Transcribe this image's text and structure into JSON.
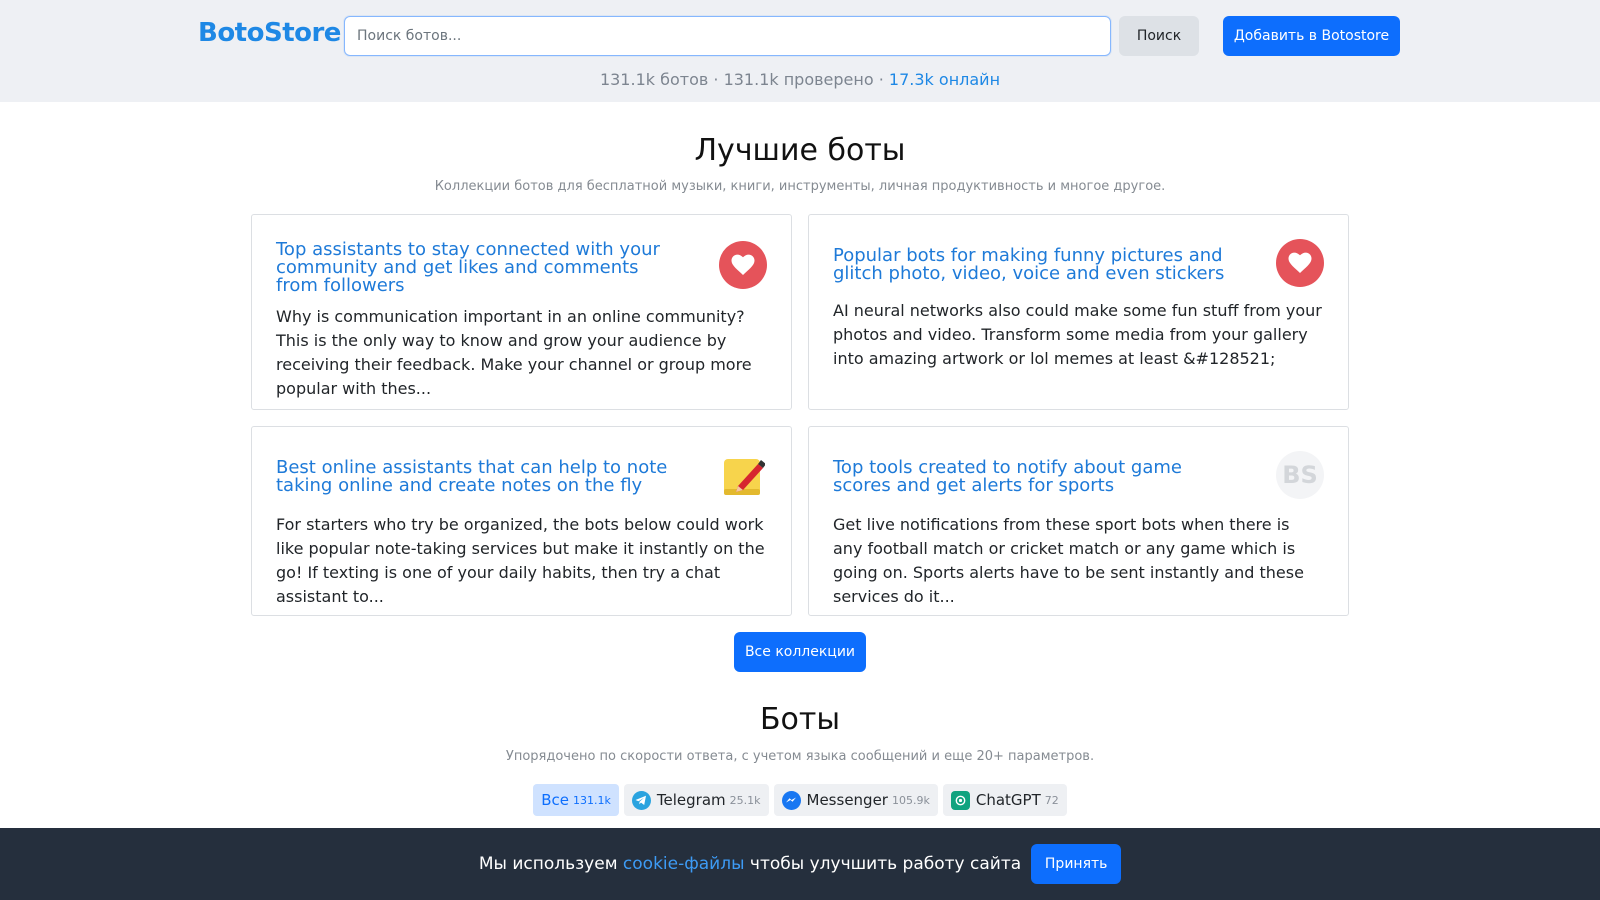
{
  "header": {
    "logo": "BotoStore",
    "search_placeholder": "Поиск ботов...",
    "search_button": "Поиск",
    "add_button": "Добавить в Botostore",
    "stats_bots": "131.1k ботов",
    "stats_sep1": " · ",
    "stats_verified": "131.1k проверено",
    "stats_sep2": " · ",
    "stats_online": "17.3k онлайн"
  },
  "best": {
    "title": "Лучшие боты",
    "subtitle": "Коллекции ботов для бесплатной музыки, книги, инструменты, личная продуктивность и многое другое.",
    "cards": [
      {
        "title": "Top assistants to stay connected with your community and get likes and comments from followers",
        "text": "Why is communication important in an online community? This is the only way to know and grow your audience by receiving their feedback. Make your channel or group more popular with thes...",
        "icon": "heart-icon"
      },
      {
        "title": "Popular bots for making funny pictures and glitch photo, video, voice and even stickers",
        "text": "AI neural networks also could make some fun stuff from your photos and video. Transform some media from your gallery into amazing artwork or lol memes at least &#128521;",
        "icon": "heart-icon"
      },
      {
        "title": "Best online assistants that can help to note taking online and create notes on the fly",
        "text": "For starters who try be organized, the bots below could work like popular note-taking services but make it instantly on the go! If texting is one of your daily habits, then try a chat assistant to...",
        "icon": "memo-icon"
      },
      {
        "title": "Top tools created to notify about game scores and get alerts for sports",
        "text": "Get live notifications from these sport bots when there is any football match or cricket match or any game which is going on. Sports alerts have to be sent instantly and these services do it...",
        "icon": "bs-placeholder-icon",
        "icon_text": "BS"
      }
    ],
    "all_button": "Все коллекции"
  },
  "bots": {
    "title": "Боты",
    "subtitle": "Упорядочено по скорости ответа, с учетом языка сообщений и еще 20+ параметров.",
    "filters": [
      {
        "label": "Все",
        "count": "131.1k",
        "active": true
      },
      {
        "label": "Telegram",
        "count": "25.1k",
        "icon": "telegram-icon"
      },
      {
        "label": "Messenger",
        "count": "105.9k",
        "icon": "messenger-icon"
      },
      {
        "label": "ChatGPT",
        "count": "72",
        "icon": "chatgpt-icon"
      }
    ]
  },
  "cookie": {
    "text_before": "Мы используем ",
    "link": "cookie-файлы",
    "text_after": " чтобы улучшить работу сайта",
    "accept": "Принять"
  },
  "colors": {
    "accent": "#0d6efd",
    "logo": "#1e88e5",
    "heart": "#e5535a",
    "cookie_bg": "#252f3d"
  }
}
